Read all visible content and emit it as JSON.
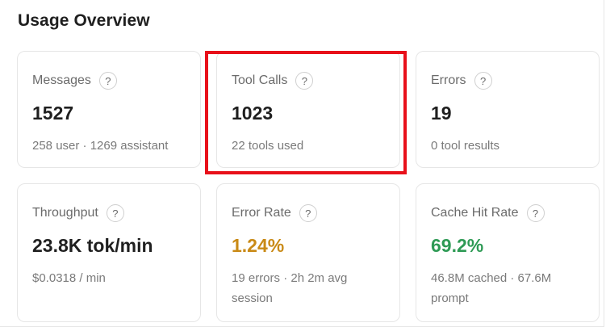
{
  "header": {
    "title": "Usage Overview"
  },
  "help_glyph": "?",
  "highlight_color": "#e8101a",
  "cards": {
    "messages": {
      "label": "Messages",
      "value": "1527",
      "sub": "258 user · 1269 assistant"
    },
    "tool_calls": {
      "label": "Tool Calls",
      "value": "1023",
      "sub": "22 tools used"
    },
    "errors": {
      "label": "Errors",
      "value": "19",
      "sub": "0 tool results"
    },
    "throughput": {
      "label": "Throughput",
      "value": "23.8K tok/min",
      "sub": "$0.0318 / min"
    },
    "error_rate": {
      "label": "Error Rate",
      "value": "1.24%",
      "value_color": "#c98a16",
      "sub": "19 errors · 2h 2m avg session"
    },
    "cache_hit_rate": {
      "label": "Cache Hit Rate",
      "value": "69.2%",
      "value_color": "#2e9a55",
      "sub": "46.8M cached · 67.6M prompt"
    }
  }
}
